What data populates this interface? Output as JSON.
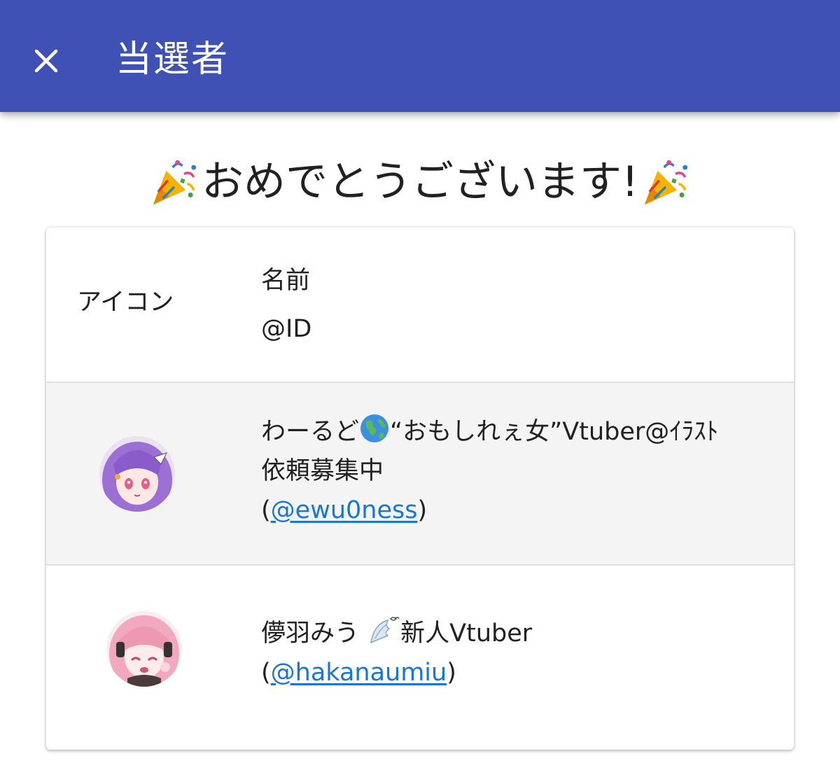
{
  "appbar": {
    "title": "当選者",
    "close_icon": "close-icon",
    "background": "#3f51b5"
  },
  "congrats": {
    "text": "おめでとうございます!",
    "icon": "party-popper-icon"
  },
  "table": {
    "header": {
      "icon_label": "アイコン",
      "name_label": "名前",
      "id_label": "@ID"
    },
    "rows": [
      {
        "name_before_emoji": "わーるど",
        "emoji": "globe-icon",
        "name_after_emoji_line1": "“おもしれぇ女”Vtuber@ｲﾗｽﾄ",
        "name_line2": "依頼募集中",
        "handle_open": "(",
        "handle": "@ewu0ness",
        "handle_close": ")",
        "avatar": "avatar-purple-hair"
      },
      {
        "name_before_emoji": "儚羽みう",
        "emoji": "wing-icon",
        "name_after_emoji_line1": "新人Vtuber",
        "handle_open": "(",
        "handle": "@hakanaumiu",
        "handle_close": ")",
        "avatar": "avatar-pink-hair"
      }
    ]
  },
  "colors": {
    "link": "#1976d2",
    "row_highlight": "#f4f4f4"
  }
}
